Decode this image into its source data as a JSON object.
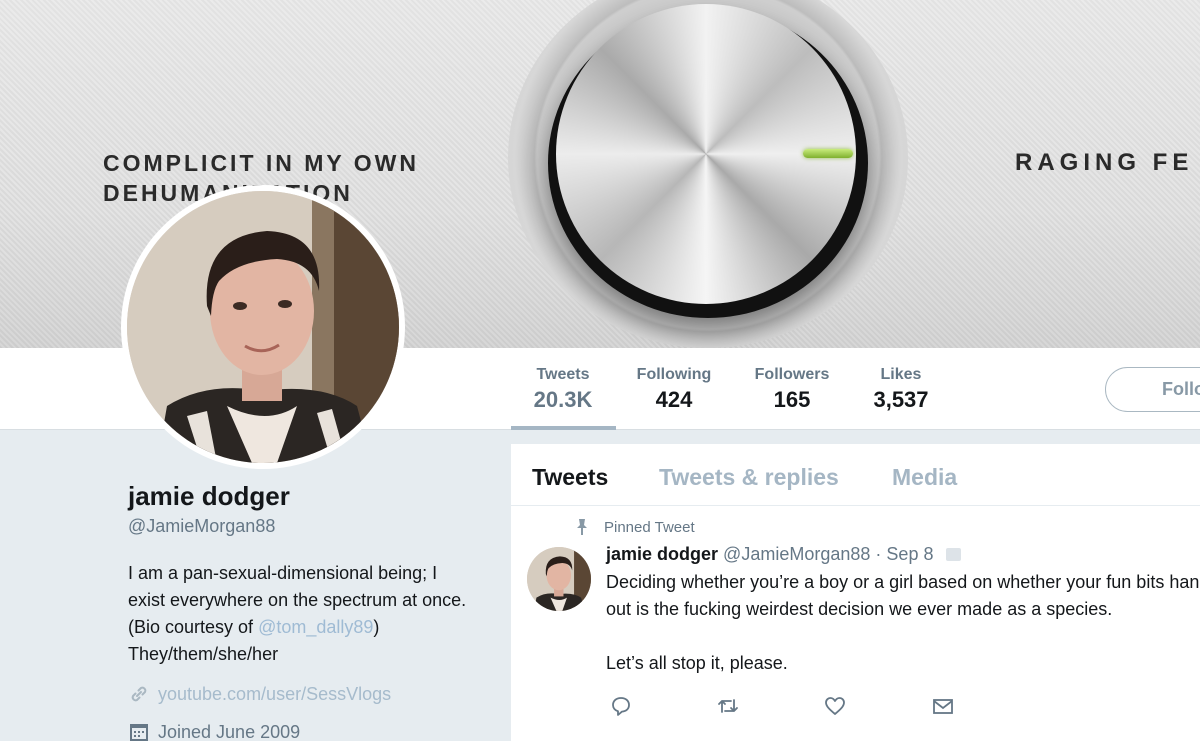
{
  "banner": {
    "left_text_line1": "COMPLICIT IN MY OWN",
    "left_text_line2": "DEHUMANIZATION",
    "right_text": "RAGING FE",
    "indicator_color": "#9ccc4a"
  },
  "stats": {
    "tweets": {
      "label": "Tweets",
      "value": "20.3K"
    },
    "following": {
      "label": "Following",
      "value": "424"
    },
    "followers": {
      "label": "Followers",
      "value": "165"
    },
    "likes": {
      "label": "Likes",
      "value": "3,537"
    }
  },
  "follow_button": {
    "label": "Follow"
  },
  "profile": {
    "name": "jamie dodger",
    "handle": "@JamieMorgan88",
    "bio_part1": "I am a pan-sexual-dimensional being; I exist everywhere on the spectrum at once. (Bio courtesy of ",
    "bio_mention": "@tom_dally89",
    "bio_part2": ")",
    "bio_line_last": "They/them/she/her",
    "website": "youtube.com/user/SessVlogs",
    "joined": "Joined June 2009"
  },
  "timeline": {
    "tabs": [
      {
        "label": "Tweets"
      },
      {
        "label": "Tweets & replies"
      },
      {
        "label": "Media"
      }
    ],
    "pinned_label": "Pinned Tweet",
    "tweet": {
      "name": "jamie dodger",
      "handle": "@JamieMorgan88",
      "separator": "·",
      "date": "Sep 8",
      "text": "Deciding whether you’re a boy or a girl based on whether your fun bits hang\nout is the fucking weirdest decision we ever made as a species.\n\nLet’s all stop it, please."
    },
    "actions": [
      "reply-icon",
      "retweet-icon",
      "like-icon",
      "message-icon"
    ]
  },
  "colors": {
    "background": "#e6ecf0",
    "muted_text": "#657786",
    "link_faded": "#9fbbd4",
    "tab_inactive": "#a5b6c4"
  }
}
